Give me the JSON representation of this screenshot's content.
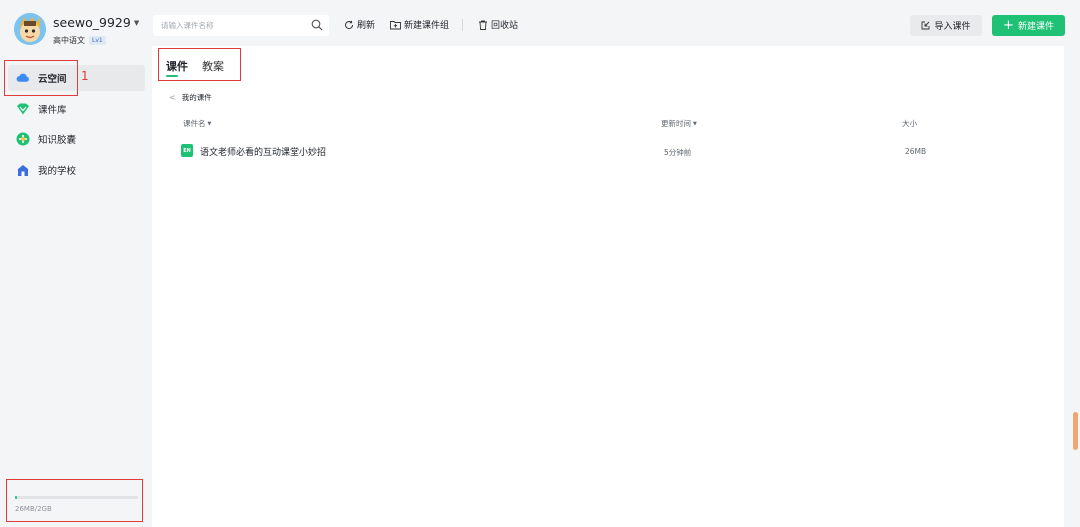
{
  "user": {
    "name": "seewo_9929",
    "subject": "高中语文",
    "level": "Lv1"
  },
  "sidebar": {
    "items": [
      {
        "label": "云空间",
        "icon": "cloud-icon"
      },
      {
        "label": "课件库",
        "icon": "courseware-library-icon"
      },
      {
        "label": "知识胶囊",
        "icon": "knowledge-capsule-icon"
      },
      {
        "label": "我的学校",
        "icon": "school-icon"
      }
    ],
    "annotation_number": "1",
    "storage": {
      "text": "26MB/2GB",
      "used_fraction": 0.0127
    }
  },
  "toolbar": {
    "search_placeholder": "请输入课件名称",
    "refresh_label": "刷新",
    "new_group_label": "新建课件组",
    "recycle_label": "回收站",
    "import_label": "导入课件",
    "new_courseware_label": "新建课件"
  },
  "main": {
    "tabs": [
      {
        "label": "课件",
        "active": true
      },
      {
        "label": "教案",
        "active": false
      }
    ],
    "breadcrumb": "我的课件",
    "columns": {
      "name": "课件名",
      "updated": "更新时间",
      "size": "大小"
    },
    "rows": [
      {
        "icon_text": "EN",
        "name": "语文老师必看的互动课堂小妙招",
        "updated": "5分钟前",
        "size": "26MB"
      }
    ]
  },
  "colors": {
    "accent": "#1fc175",
    "annotation": "#e23b3b"
  }
}
